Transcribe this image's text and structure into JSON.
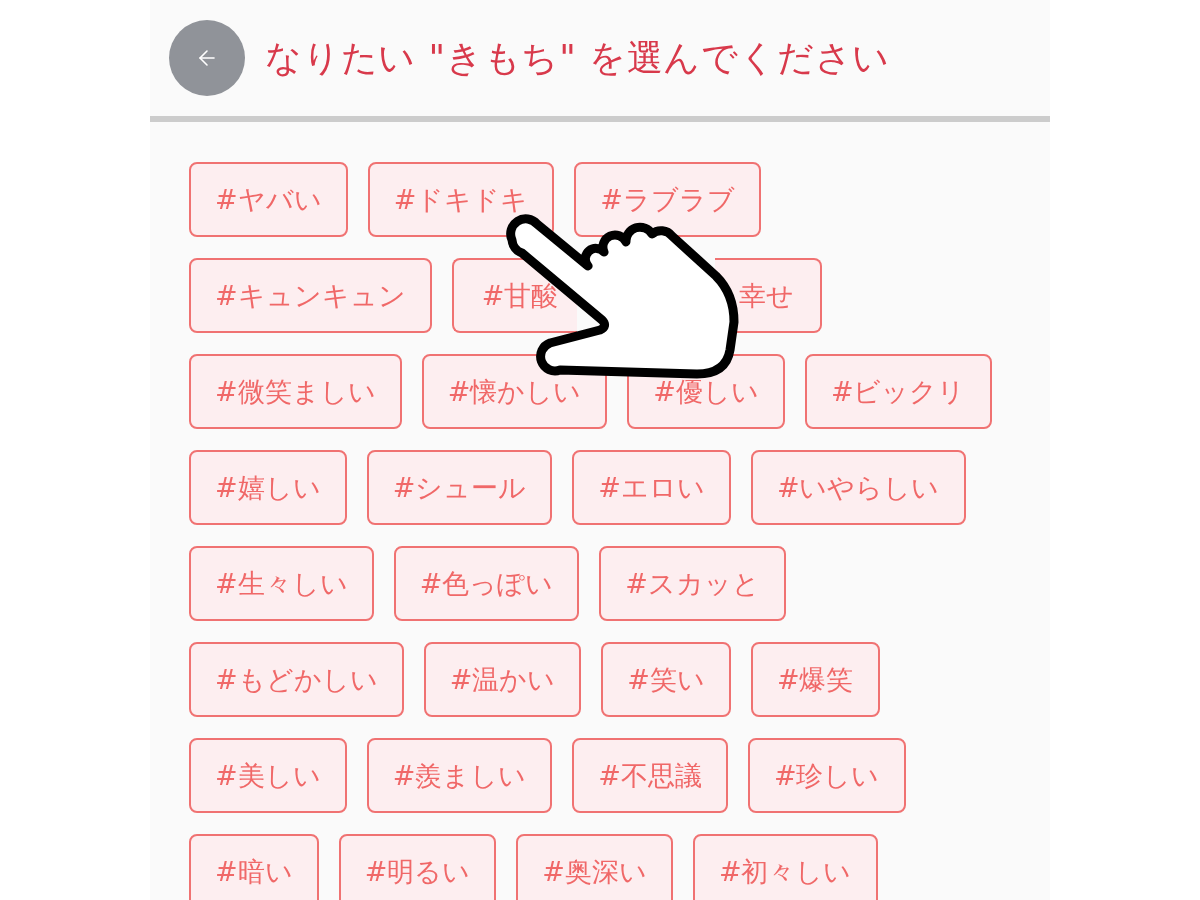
{
  "header": {
    "title": "なりたい \"きもち\" を選んでください"
  },
  "tag_rows": [
    {
      "tags": [
        {
          "label": "#ヤバい",
          "kind": "full"
        },
        {
          "label": "#ドキドキ",
          "kind": "full"
        },
        {
          "label": "#ラブラブ",
          "kind": "full"
        }
      ]
    },
    {
      "tags": [
        {
          "label": "#キュンキュン",
          "kind": "full"
        },
        {
          "label": "#甘酸",
          "kind": "clipped_end"
        },
        {
          "label": "幸せ",
          "kind": "clipped_start"
        }
      ]
    },
    {
      "tags": [
        {
          "label": "#微笑ましい",
          "kind": "full"
        },
        {
          "label": "#懐かしい",
          "kind": "full"
        },
        {
          "label": "#優しい",
          "kind": "full"
        },
        {
          "label": "#ビックリ",
          "kind": "full"
        }
      ]
    },
    {
      "tags": [
        {
          "label": "#嬉しい",
          "kind": "full"
        },
        {
          "label": "#シュール",
          "kind": "full"
        },
        {
          "label": "#エロい",
          "kind": "full"
        },
        {
          "label": "#いやらしい",
          "kind": "full"
        }
      ]
    },
    {
      "tags": [
        {
          "label": "#生々しい",
          "kind": "full"
        },
        {
          "label": "#色っぽい",
          "kind": "full"
        },
        {
          "label": "#スカッと",
          "kind": "full"
        }
      ]
    },
    {
      "tags": [
        {
          "label": "#もどかしい",
          "kind": "full"
        },
        {
          "label": "#温かい",
          "kind": "full"
        },
        {
          "label": "#笑い",
          "kind": "full"
        },
        {
          "label": "#爆笑",
          "kind": "full"
        }
      ]
    },
    {
      "tags": [
        {
          "label": "#美しい",
          "kind": "full"
        },
        {
          "label": "#羨ましい",
          "kind": "full"
        },
        {
          "label": "#不思議",
          "kind": "full"
        },
        {
          "label": "#珍しい",
          "kind": "full"
        }
      ]
    },
    {
      "tags": [
        {
          "label": "#暗い",
          "kind": "full"
        },
        {
          "label": "#明るい",
          "kind": "full"
        },
        {
          "label": "#奥深い",
          "kind": "full"
        },
        {
          "label": "#初々しい",
          "kind": "full"
        }
      ]
    }
  ]
}
